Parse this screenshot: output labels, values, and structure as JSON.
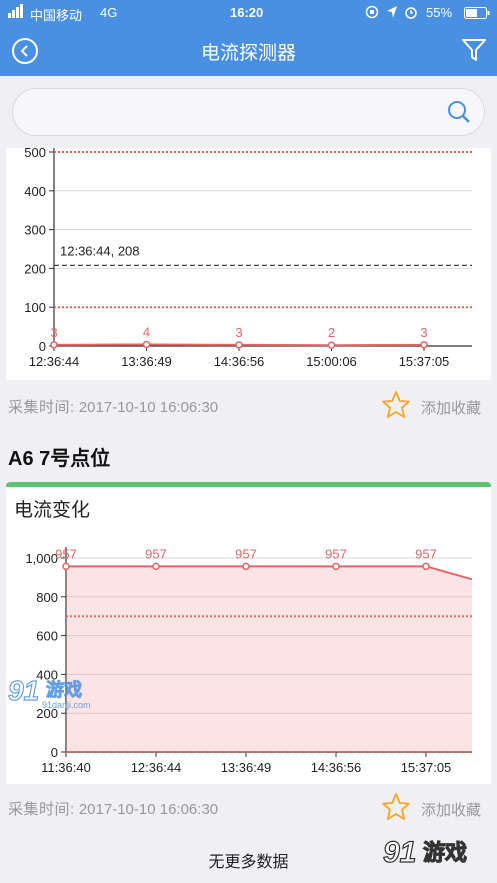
{
  "status_bar": {
    "carrier": "中国移动",
    "network": "4G",
    "time": "16:20",
    "battery": "55%"
  },
  "nav": {
    "title": "电流探测器"
  },
  "search": {
    "value": "",
    "placeholder": ""
  },
  "sensor1": {
    "collect_label": "采集时间:",
    "collect_time": "2017-10-10 16:06:30",
    "favorite_label": "添加收藏"
  },
  "sensor2": {
    "name": "A6 7号点位",
    "card_title": "电流变化",
    "collect_label": "采集时间:",
    "collect_time": "2017-10-10 16:06:30",
    "favorite_label": "添加收藏"
  },
  "footer": {
    "no_more": "无更多数据"
  },
  "watermark": {
    "brand": "游戏",
    "url": "91danji.com"
  },
  "colors": {
    "header": "#4a90e2",
    "accent_green": "#5cc46a",
    "series": "#e06666",
    "limit_line": "#e06666",
    "star": "#f5a623"
  },
  "chart_data": [
    {
      "type": "line",
      "x": [
        "12:36:44",
        "13:36:49",
        "14:36:56",
        "15:00:06",
        "15:37:05"
      ],
      "series": [
        {
          "values": [
            3,
            4,
            3,
            2,
            3
          ],
          "labels": [
            "3",
            "4",
            "3",
            "2",
            "3"
          ]
        }
      ],
      "ylim": [
        0,
        500
      ],
      "yticks": [
        0,
        100,
        200,
        300,
        400,
        500
      ],
      "reference_lines": [
        {
          "value": 500,
          "style": "dotted-red"
        },
        {
          "value": 100,
          "style": "dotted-red"
        },
        {
          "value": 208,
          "style": "dashed-black",
          "label": "12:36:44, 208"
        }
      ],
      "grid": true
    },
    {
      "type": "area",
      "x": [
        "11:36:40",
        "12:36:44",
        "13:36:49",
        "14:36:56",
        "15:37:05"
      ],
      "series": [
        {
          "values": [
            957,
            957,
            957,
            957,
            957
          ],
          "labels": [
            "957",
            "957",
            "957",
            "957",
            "957"
          ],
          "tail_value": 890
        }
      ],
      "ylim": [
        0,
        1000
      ],
      "yticks": [
        "0",
        "200",
        "400",
        "600",
        "800",
        "1,000"
      ],
      "reference_lines": [
        {
          "value": 700,
          "style": "dotted-red"
        },
        {
          "value": 0,
          "style": "dotted-red"
        }
      ],
      "grid": true
    }
  ]
}
